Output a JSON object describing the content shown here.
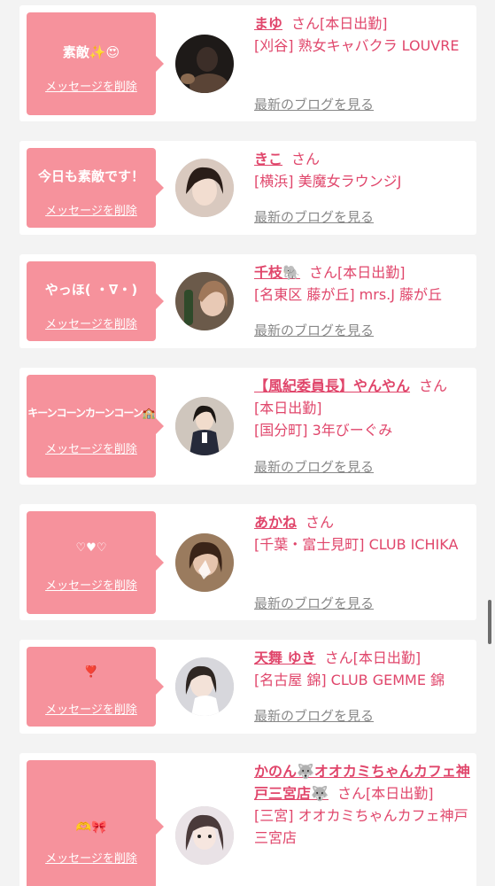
{
  "delete_label": "メッセージを削除",
  "san_label": "さん",
  "blog_label": "最新のブログを見る",
  "cards": [
    {
      "message": "素敵✨😍",
      "name": "まゆ",
      "status": "[本日出勤]",
      "shop": "[刈谷] 熟女キャバクラ LOUVRE"
    },
    {
      "message": "今日も素敵です！",
      "name": "きこ",
      "status": "",
      "shop": "[横浜] 美魔女ラウンジJ"
    },
    {
      "message": "やっほ( ・∇・)",
      "name": "千枝🐘",
      "status": "[本日出勤]",
      "shop": "[名東区 藤が丘] mrs.J 藤が丘"
    },
    {
      "message": "キーンコーンカーンコーン🏫",
      "name": "【風紀委員長】やんやん",
      "status": "[本日出勤]",
      "shop": "[国分町] 3年びーぐみ"
    },
    {
      "message": "♡♥♡",
      "name": "あかね",
      "status": "",
      "shop": "[千葉・富士見町] CLUB ICHIKA"
    },
    {
      "message": "❣️",
      "name": "天舞 ゆき",
      "status": "[本日出勤]",
      "shop": "[名古屋 錦] CLUB GEMME 錦"
    },
    {
      "message": "🫶🎀",
      "name": "かのん🐺オオカミちゃんカフェ神戸三宮店🐺",
      "status": "[本日出勤]",
      "shop": "[三宮] オオカミちゃんカフェ神戸三宮店"
    }
  ],
  "colors": {
    "accent": "#e0466b",
    "bubble": "#f6929c",
    "link_gray": "#888888"
  }
}
